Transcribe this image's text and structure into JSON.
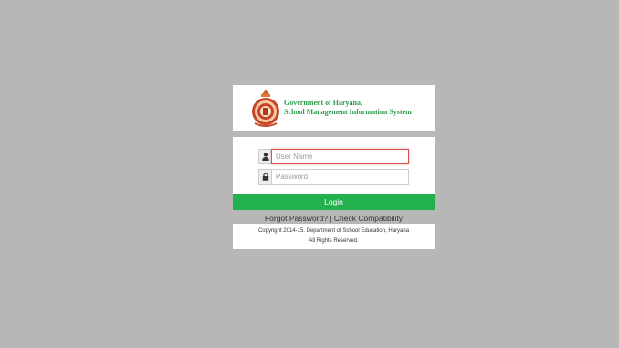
{
  "header": {
    "title_line1": "Government of Haryana,",
    "title_line2": "School Management Information System"
  },
  "form": {
    "username": {
      "placeholder": "User Name",
      "value": "",
      "icon": "user-icon"
    },
    "password": {
      "placeholder": "Password",
      "value": "",
      "icon": "lock-icon"
    },
    "login_label": "Login"
  },
  "links": {
    "forgot_password": "Forgot Password?",
    "separator": "|",
    "check_compatibility": "Check Compatibility"
  },
  "footer": {
    "line1": "Copyright 2014-15. Department of School Education, Haryana",
    "line2": "All Rights Reserved."
  },
  "colors": {
    "page_background": "#b7b7b7",
    "brand_green": "#2a9a4a",
    "login_button": "#23b14d",
    "focus_border": "#d9534f"
  }
}
